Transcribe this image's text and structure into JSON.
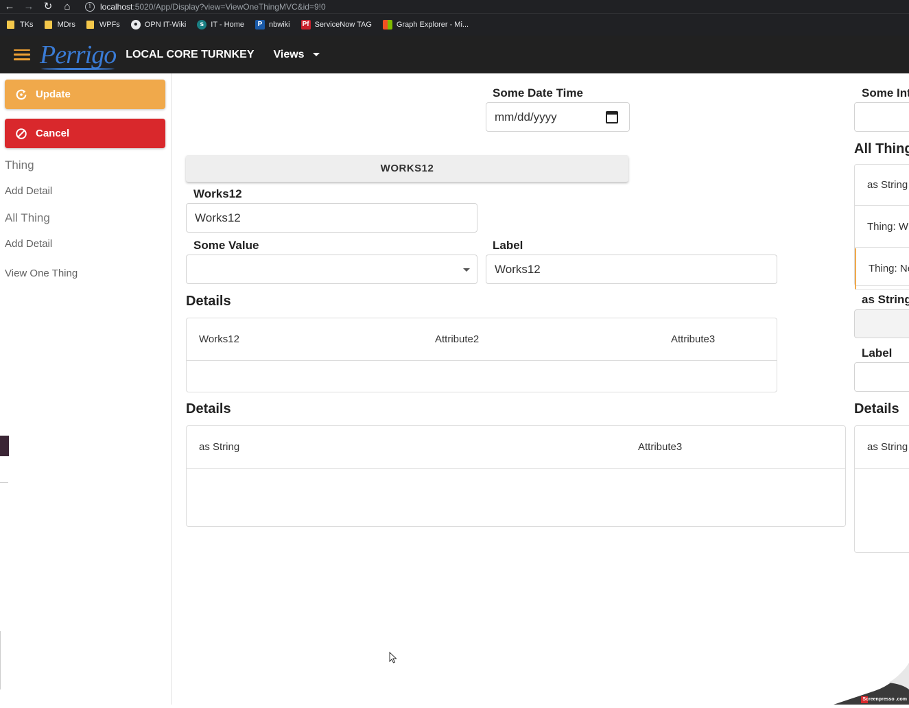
{
  "browser": {
    "url_host": "localhost",
    "url_path": ":5020/App/Display?view=ViewOneThingMVC&id=9!0",
    "bookmarks": [
      {
        "label": "TKs",
        "icon": "folder-icon"
      },
      {
        "label": "MDrs",
        "icon": "folder-icon"
      },
      {
        "label": "WPFs",
        "icon": "folder-icon"
      },
      {
        "label": "OPN IT-Wiki",
        "icon": "globe-icon"
      },
      {
        "label": "IT - Home",
        "icon": "sharepoint-icon"
      },
      {
        "label": "nbwiki",
        "icon": "p-icon"
      },
      {
        "label": "ServiceNow TAG",
        "icon": "pf-icon"
      },
      {
        "label": "Graph Explorer - Mi...",
        "icon": "microsoft-icon"
      }
    ]
  },
  "header": {
    "logo": "Perrigo",
    "title": "LOCAL CORE TURNKEY",
    "views_label": "Views"
  },
  "drawer": {
    "update_label": "Update",
    "cancel_label": "Cancel",
    "section_thing": "Thing",
    "link_add_detail_1": "Add Detail",
    "section_all_thing": "All Thing",
    "link_add_detail_2": "Add Detail",
    "link_view_one_thing": "View One Thing"
  },
  "form": {
    "date_label": "Some Date Time",
    "date_placeholder": "mm/dd/yyyy",
    "group_title": "WORKS12",
    "works12_label": "Works12",
    "works12_value": "Works12",
    "some_value_label": "Some Value",
    "some_value_selected": "",
    "label_label": "Label",
    "label_value": "Works12"
  },
  "details1": {
    "title": "Details",
    "columns": [
      "Works12",
      "Attribute2",
      "Attribute3"
    ]
  },
  "details2": {
    "title": "Details",
    "columns": [
      "as String",
      "Attribute3"
    ]
  },
  "right_column": {
    "some_int_label": "Some Int",
    "all_thing_title": "All Thing",
    "items": [
      "as String",
      "Thing: W",
      "Thing: Ne"
    ],
    "as_string_label": "as String",
    "label_label": "Label",
    "details_title": "Details",
    "details_col": "as String"
  },
  "watermark": "Screenpresso .com",
  "colors": {
    "update": "#f0a94b",
    "cancel": "#d9282c",
    "header_bg": "#212121",
    "logo": "#3a7bd5"
  }
}
